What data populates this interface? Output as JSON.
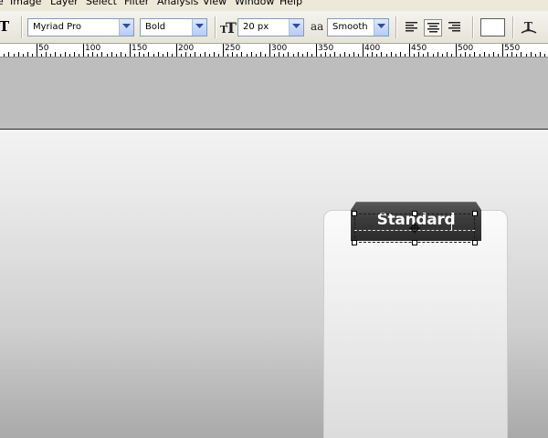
{
  "menubar": {
    "items": [
      "Image",
      "Layer",
      "Select",
      "Filter",
      "Analysis",
      "View",
      "Window",
      "Help"
    ]
  },
  "options": {
    "tool_glyph": "T",
    "font_family": "Myriad Pro",
    "font_style": "Bold",
    "font_size": "20 px",
    "antialias_glyph": "aa",
    "antialias": "Smooth",
    "text_color": "#ffffff",
    "icons": [
      "text-tool-icon",
      "text-orientation-icon",
      "font-size-icon",
      "antialias-icon",
      "align-left-icon",
      "align-center-icon",
      "align-right-icon",
      "text-color-swatch",
      "warp-text-icon"
    ]
  },
  "ruler": {
    "labels": [
      "50",
      "100",
      "150",
      "200",
      "250",
      "300",
      "350",
      "400",
      "450",
      "500",
      "550"
    ]
  },
  "canvas": {
    "tab_text": "Standard",
    "tab_color": "#3b3b3b",
    "card_color": "#f4f4f4"
  }
}
